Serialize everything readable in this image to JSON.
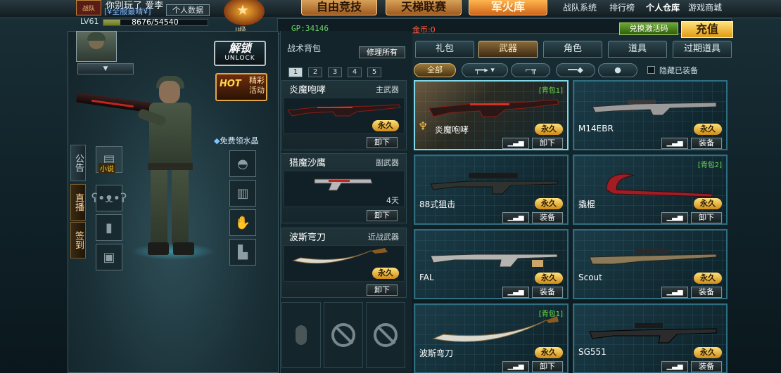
{
  "player": {
    "name": "你别玩了 爱李",
    "server": "[¥全服最晴¥]",
    "profile_btn": "个人数据",
    "level": "LV61",
    "xp_text": "8676/54540",
    "xp_fraction": 0.159,
    "rank_label": "II级",
    "emblem_text": "战队"
  },
  "nav": {
    "tabs": [
      "自由竞技",
      "天梯联赛",
      "军火库"
    ],
    "active_tab": "军火库",
    "links": [
      "战队系统",
      "排行榜",
      "个人仓库",
      "游戏商城"
    ]
  },
  "currency": {
    "gp": "GP:34146",
    "gold": "金币:0"
  },
  "buttons": {
    "redeem": "兑换激活码",
    "recharge": "充值",
    "unlock_cn": "解锁",
    "unlock_en": "UNLOCK",
    "hot_tag": "HOT",
    "hot_text": "精彩活动",
    "crystal": "免费领水晶",
    "repair": "修理所有"
  },
  "side_tabs": [
    "公告",
    "直播",
    "签到"
  ],
  "slots": {
    "book_label": "小说"
  },
  "bag": {
    "title": "战术背包",
    "numbers": [
      "1",
      "2",
      "3",
      "4",
      "5"
    ],
    "items": [
      {
        "name": "炎魔咆哮",
        "type": "主武器",
        "status": "永久",
        "action": "卸下"
      },
      {
        "name": "猎魔沙鹰",
        "type": "副武器",
        "status": "4天",
        "action": "卸下"
      },
      {
        "name": "波斯弯刀",
        "type": "近战武器",
        "status": "永久",
        "action": "卸下"
      }
    ]
  },
  "shop": {
    "categories": [
      "礼包",
      "武器",
      "角色",
      "道具",
      "过期道具"
    ],
    "active_category": "武器",
    "subtabs": [
      "全部",
      "rifle-icon",
      "pistol-icon",
      "melee-icon",
      "grenade-icon"
    ],
    "hide_equipped": "隐藏已装备",
    "stat_icon": "stats-bars-icon",
    "items": [
      {
        "name": "炎魔咆哮",
        "tag": "[背包1]",
        "status": "永久",
        "action": "卸下",
        "selected": true
      },
      {
        "name": "M14EBR",
        "tag": "",
        "status": "永久",
        "action": "装备"
      },
      {
        "name": "88式狙击",
        "tag": "",
        "status": "永久",
        "action": "装备"
      },
      {
        "name": "撬棍",
        "tag": "[背包2]",
        "status": "永久",
        "action": "卸下"
      },
      {
        "name": "FAL",
        "tag": "",
        "status": "永久",
        "action": "装备"
      },
      {
        "name": "Scout",
        "tag": "",
        "status": "永久",
        "action": "装备"
      },
      {
        "name": "波斯弯刀",
        "tag": "[背包1]",
        "status": "永久",
        "action": "卸下"
      },
      {
        "name": "SG551",
        "tag": "",
        "status": "永久",
        "action": "装备"
      }
    ]
  },
  "colors": {
    "accent": "#e0b46b",
    "card_border": "#2f6d80",
    "gp": "#6ed16a",
    "gold": "#ff5a3c"
  }
}
